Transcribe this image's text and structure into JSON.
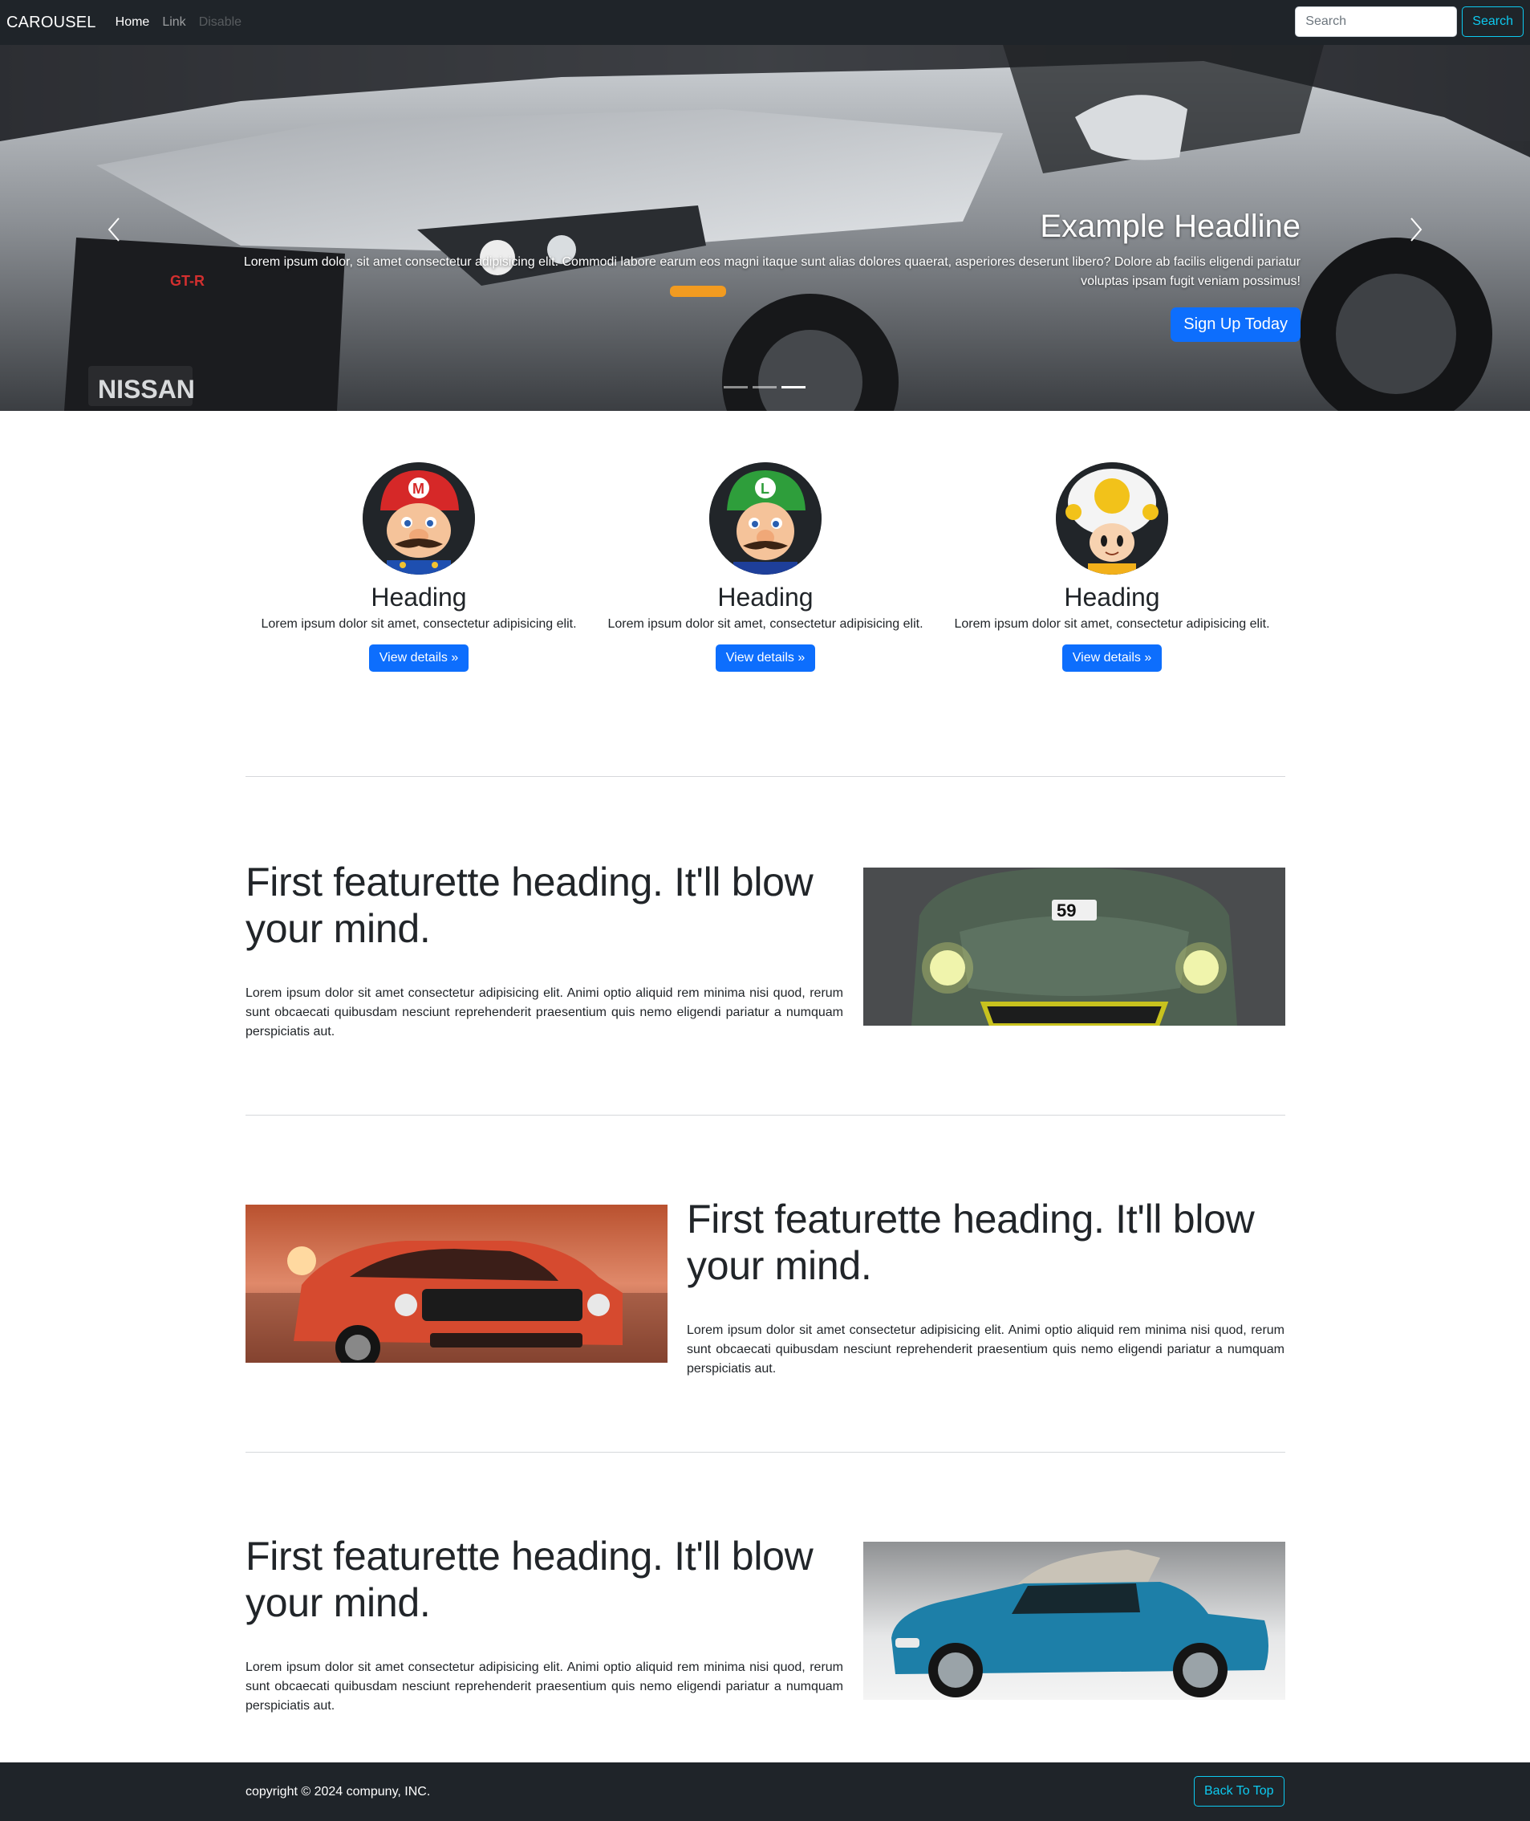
{
  "navbar": {
    "brand": "CAROUSEL",
    "links": [
      {
        "label": "Home"
      },
      {
        "label": "Link"
      },
      {
        "label": "Disable"
      }
    ],
    "search_placeholder": "Search",
    "search_button": "Search"
  },
  "carousel": {
    "headline": "Example Headline",
    "text": "Lorem ipsum dolor, sit amet consectetur adipisicing elit. Commodi labore earum eos magni itaque sunt alias dolores quaerat, asperiores deserunt libero? Dolore ab facilis eligendi pariatur voluptas ipsam fugit veniam possimus!",
    "cta": "Sign Up Today",
    "slide_count": 3,
    "active_slide": 3,
    "photo_plate": "NISSAN",
    "photo_badge": "GT-R"
  },
  "marketing": {
    "columns": [
      {
        "heading": "Heading",
        "text": "Lorem ipsum dolor sit amet, consectetur adipisicing elit.",
        "button": "View details »",
        "avatar": "mario-avatar"
      },
      {
        "heading": "Heading",
        "text": "Lorem ipsum dolor sit amet, consectetur adipisicing elit.",
        "button": "View details »",
        "avatar": "luigi-avatar"
      },
      {
        "heading": "Heading",
        "text": "Lorem ipsum dolor sit amet, consectetur adipisicing elit.",
        "button": "View details »",
        "avatar": "toad-avatar"
      }
    ]
  },
  "featurettes": [
    {
      "heading": "First featurette heading. It'll blow your mind.",
      "text": "Lorem ipsum dolor sit amet consectetur adipisicing elit. Animi optio aliquid rem minima nisi quod, rerum sunt obcaecati quibusdam nesciunt reprehenderit praesentium quis nemo eligendi pariatur a numquam perspiciatis aut.",
      "image_label": "59"
    },
    {
      "heading": "First featurette heading. It'll blow your mind.",
      "text": "Lorem ipsum dolor sit amet consectetur adipisicing elit. Animi optio aliquid rem minima nisi quod, rerum sunt obcaecati quibusdam nesciunt reprehenderit praesentium quis nemo eligendi pariatur a numquam perspiciatis aut."
    },
    {
      "heading": "First featurette heading. It'll blow your mind.",
      "text": "Lorem ipsum dolor sit amet consectetur adipisicing elit. Animi optio aliquid rem minima nisi quod, rerum sunt obcaecati quibusdam nesciunt reprehenderit praesentium quis nemo eligendi pariatur a numquam perspiciatis aut."
    }
  ],
  "footer": {
    "copyright": "copyright © 2024 compuny, INC.",
    "back_to_top": "Back To Top"
  },
  "colors": {
    "navbar_bg": "#1f2429",
    "primary": "#0d6efd",
    "outline_info": "#0dcaf0"
  }
}
